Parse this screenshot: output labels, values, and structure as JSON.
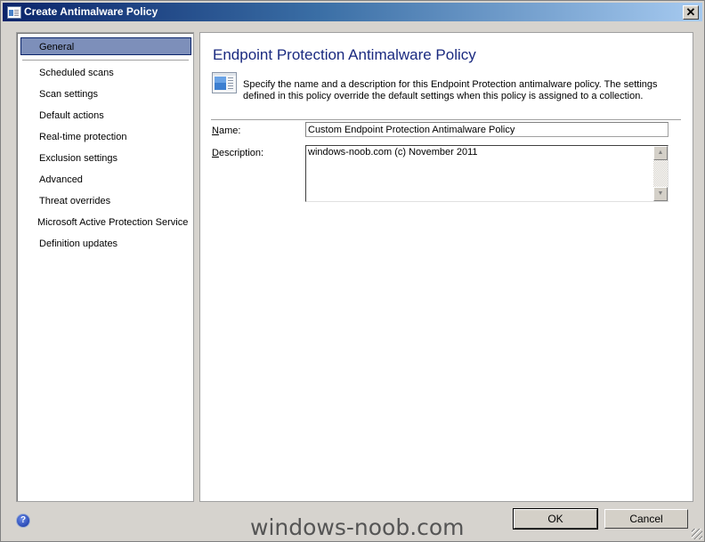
{
  "window": {
    "title": "Create Antimalware Policy",
    "close_label": "✕"
  },
  "nav": {
    "items": [
      {
        "label": "General",
        "selected": true
      },
      {
        "label": "Scheduled scans"
      },
      {
        "label": "Scan settings"
      },
      {
        "label": "Default actions"
      },
      {
        "label": "Real-time protection"
      },
      {
        "label": "Exclusion settings"
      },
      {
        "label": "Advanced"
      },
      {
        "label": "Threat overrides"
      },
      {
        "label": "Microsoft Active Protection Service"
      },
      {
        "label": "Definition updates"
      }
    ]
  },
  "main": {
    "title": "Endpoint Protection Antimalware Policy",
    "description": "Specify the name and a description for this Endpoint Protection antimalware policy. The settings defined in this policy override the default settings when this policy is assigned to a collection.",
    "name_label_accel": "N",
    "name_label_rest": "ame:",
    "name_value": "Custom Endpoint Protection Antimalware Policy",
    "description_label_accel": "D",
    "description_label_rest": "escription:",
    "description_value": "windows-noob.com (c) November 2011"
  },
  "footer": {
    "help_glyph": "?",
    "watermark": "windows-noob.com",
    "ok_label": "OK",
    "cancel_label": "Cancel"
  },
  "icons": {
    "scroll_up": "▲",
    "scroll_down": "▼"
  }
}
